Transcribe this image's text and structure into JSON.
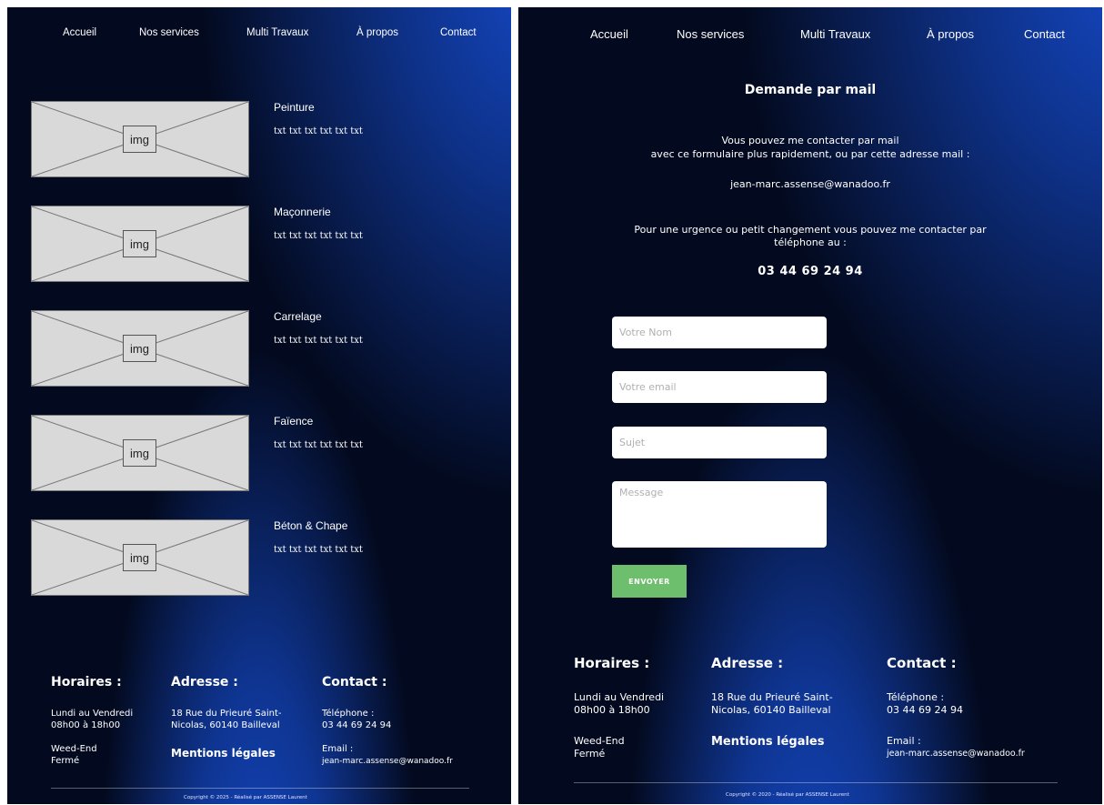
{
  "nav": {
    "items": [
      "Accueil",
      "Nos services",
      "Multi Travaux",
      "À propos",
      "Contact"
    ]
  },
  "services": {
    "image_label": "img",
    "items": [
      {
        "title": "Peinture",
        "text": "txt txt txt txt txt txt"
      },
      {
        "title": "Maçonnerie",
        "text": "txt txt txt txt txt txt"
      },
      {
        "title": "Carrelage",
        "text": "txt txt txt txt txt txt"
      },
      {
        "title": "Faïence",
        "text": "txt txt txt txt txt txt"
      },
      {
        "title": "Béton & Chape",
        "text": "txt txt txt txt txt txt"
      }
    ]
  },
  "contact": {
    "heading": "Demande par mail",
    "intro_line1": "Vous pouvez me contacter par mail",
    "intro_line2": "avec ce formulaire plus rapidement, ou par cette adresse mail :",
    "email": "jean-marc.assense@wanadoo.fr",
    "urgent_line1": "Pour une urgence ou petit changement vous pouvez me contacter par",
    "urgent_line2": "téléphone au :",
    "phone": "03 44 69 24 94",
    "form": {
      "name_placeholder": "Votre Nom",
      "email_placeholder": "Votre email",
      "subject_placeholder": "Sujet",
      "message_placeholder": "Message",
      "send_label": "ENVOYER"
    }
  },
  "footer": {
    "hours_title": "Horaires :",
    "hours_line1": "Lundi au Vendredi",
    "hours_line2": "08h00 à 18h00",
    "weekend_line1": "Weed-End",
    "weekend_line2": "Fermé",
    "address_title": "Adresse :",
    "address_line1": "18 Rue du Prieuré Saint-",
    "address_line2_left": "Nicolas, 60140 Bailleval",
    "address_line2_right": "Nicolas, 60140 Bailleval",
    "legal": "Mentions légales",
    "contact_title": "Contact :",
    "phone_label": "Téléphone :",
    "phone": "03 44 69 24 94",
    "email_label": "Email :",
    "email": "jean-marc.assense@wanadoo.fr",
    "copyright_left": "Copyright © 2025 - Réalisé par ASSENSE Laurent",
    "copyright_right": "Copyright © 2020 - Réalisé par ASSENSE Laurent"
  },
  "colors": {
    "background_dark": "#030a1f",
    "accent_blue": "#1447c2",
    "send_button": "#6dbf6d"
  }
}
